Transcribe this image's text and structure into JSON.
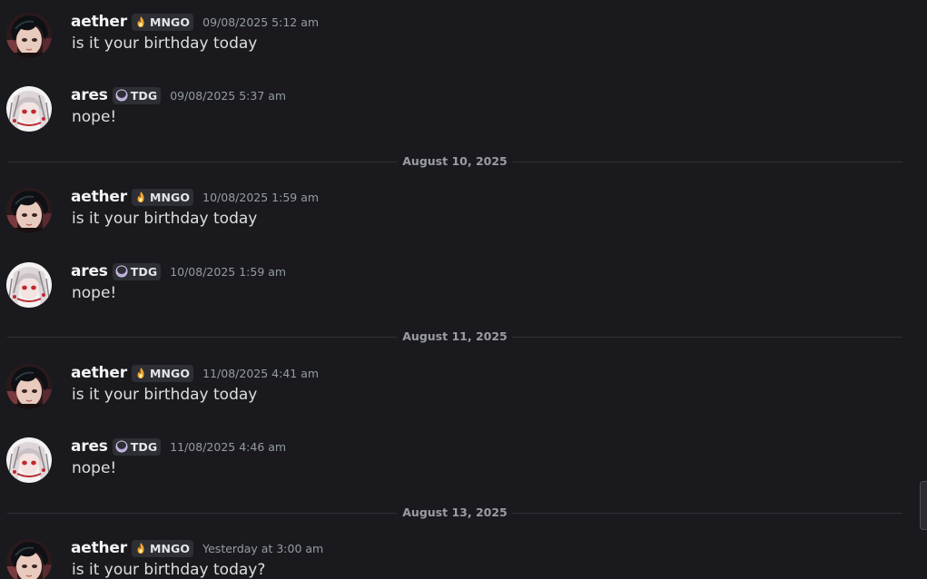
{
  "colors": {
    "background": "#1a1a1e",
    "username": "#f2f3f5",
    "message_text": "#dbdee1",
    "timestamp": "#949ba4",
    "tag_background": "#2e2f34",
    "divider_line": "#303136"
  },
  "users": {
    "aether": {
      "name": "aether",
      "tag": "MNGO",
      "tag_icon": "flame-icon",
      "avatar_icon": "dark-haired-anime-avatar"
    },
    "ares": {
      "name": "ares",
      "tag": "TDG",
      "tag_icon": "crescent-moon-icon",
      "avatar_icon": "white-haired-anime-avatar"
    }
  },
  "messages": [
    {
      "author": "aether",
      "tag": "MNGO",
      "timestamp": "09/08/2025 5:12 am",
      "text": "is it your birthday today"
    },
    {
      "author": "ares",
      "tag": "TDG",
      "timestamp": "09/08/2025 5:37 am",
      "text": "nope!"
    },
    {
      "author": "aether",
      "tag": "MNGO",
      "timestamp": "10/08/2025 1:59 am",
      "text": "is it your birthday today"
    },
    {
      "author": "ares",
      "tag": "TDG",
      "timestamp": "10/08/2025 1:59 am",
      "text": "nope!"
    },
    {
      "author": "aether",
      "tag": "MNGO",
      "timestamp": "11/08/2025 4:41 am",
      "text": "is it your birthday today"
    },
    {
      "author": "ares",
      "tag": "TDG",
      "timestamp": "11/08/2025 4:46 am",
      "text": "nope!"
    },
    {
      "author": "aether",
      "tag": "MNGO",
      "timestamp": "Yesterday at 3:00 am",
      "text": "is it your birthday today?"
    }
  ],
  "dividers": [
    {
      "label": "August 10, 2025"
    },
    {
      "label": "August 11, 2025"
    },
    {
      "label": "August 13, 2025"
    }
  ]
}
